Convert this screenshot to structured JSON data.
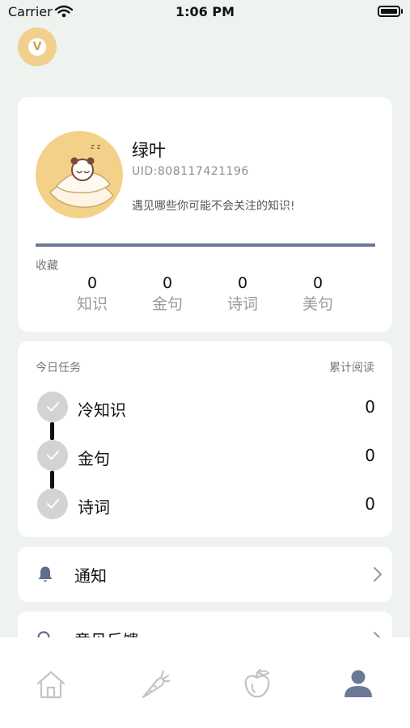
{
  "status_bar": {
    "carrier": "Carrier",
    "time": "1:06 PM"
  },
  "vip_badge": {
    "letter": "V"
  },
  "profile": {
    "name": "绿叶",
    "uid_label": "UID:",
    "uid_value": "808117421196",
    "tagline": "遇见哪些你可能不会关注的知识!",
    "favorites_label": "收藏",
    "stats": [
      {
        "count": "0",
        "label": "知识"
      },
      {
        "count": "0",
        "label": "金句"
      },
      {
        "count": "0",
        "label": "诗词"
      },
      {
        "count": "0",
        "label": "美句"
      }
    ]
  },
  "tasks": {
    "title": "今日任务",
    "reads_title": "累计阅读",
    "items": [
      {
        "label": "冷知识",
        "count": "0",
        "done": true
      },
      {
        "label": "金句",
        "count": "0",
        "done": true
      },
      {
        "label": "诗词",
        "count": "0",
        "done": true
      }
    ]
  },
  "menu": {
    "notify": {
      "label": "通知",
      "icon": "bell-icon"
    },
    "feedback": {
      "label": "意见反馈",
      "icon": "feedback-icon"
    }
  },
  "tab_bar": {
    "tabs": [
      {
        "icon": "home-icon",
        "active": false
      },
      {
        "icon": "carrot-icon",
        "active": false
      },
      {
        "icon": "fruit-icon",
        "active": false
      },
      {
        "icon": "person-icon",
        "active": true
      }
    ]
  },
  "colors": {
    "background": "#eef3ef",
    "accent": "#6b7996",
    "vip_gold": "#f1d08d",
    "tab_inactive": "#c3c3c3",
    "tab_active": "#6b7996"
  }
}
